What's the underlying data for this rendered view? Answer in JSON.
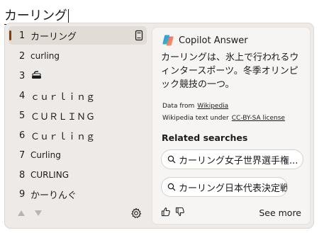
{
  "composition": {
    "text": "カーリング"
  },
  "candidates": [
    {
      "number": "1",
      "text": "カーリング"
    },
    {
      "number": "2",
      "text": "curling"
    },
    {
      "number": "3",
      "text": "🥌"
    },
    {
      "number": "4",
      "text": "ｃｕｒｌｉｎｇ"
    },
    {
      "number": "5",
      "text": "ＣＵＲＬＩＮＧ"
    },
    {
      "number": "6",
      "text": "Ｃｕｒｌｉｎｇ"
    },
    {
      "number": "7",
      "text": "Curling"
    },
    {
      "number": "8",
      "text": "CURLING"
    },
    {
      "number": "9",
      "text": "かーりんぐ"
    }
  ],
  "selected_index": 1,
  "icons": {
    "candidate_action": "tablet-icon",
    "page_up": "triangle-up-icon",
    "page_down": "triangle-down-icon",
    "settings": "gear-icon",
    "copilot": "copilot-logo-icon",
    "search": "search-icon",
    "like": "thumbs-up-icon",
    "dislike": "thumbs-down-icon"
  },
  "copilot": {
    "title": "Copilot Answer",
    "answer": "カーリングは、氷上で行われるウィンタースポーツ。冬季オリンピック競技の一つ。",
    "source_prefix": "Data from",
    "source_link": "Wikipedia",
    "license_prefix": "Wikipedia text under",
    "license_link": "CC-BY-SA license",
    "related_heading": "Related searches",
    "related": [
      "カーリング女子世界選手権...",
      "カーリング日本代表決定戦"
    ],
    "see_more": "See more"
  },
  "colors": {
    "panel_bg": "#eeeae7",
    "selected_bg": "#e2dcd7",
    "selection_accent": "#8a3d00",
    "card_bg": "#f7f5f3",
    "chip_bg": "#ffffff"
  }
}
